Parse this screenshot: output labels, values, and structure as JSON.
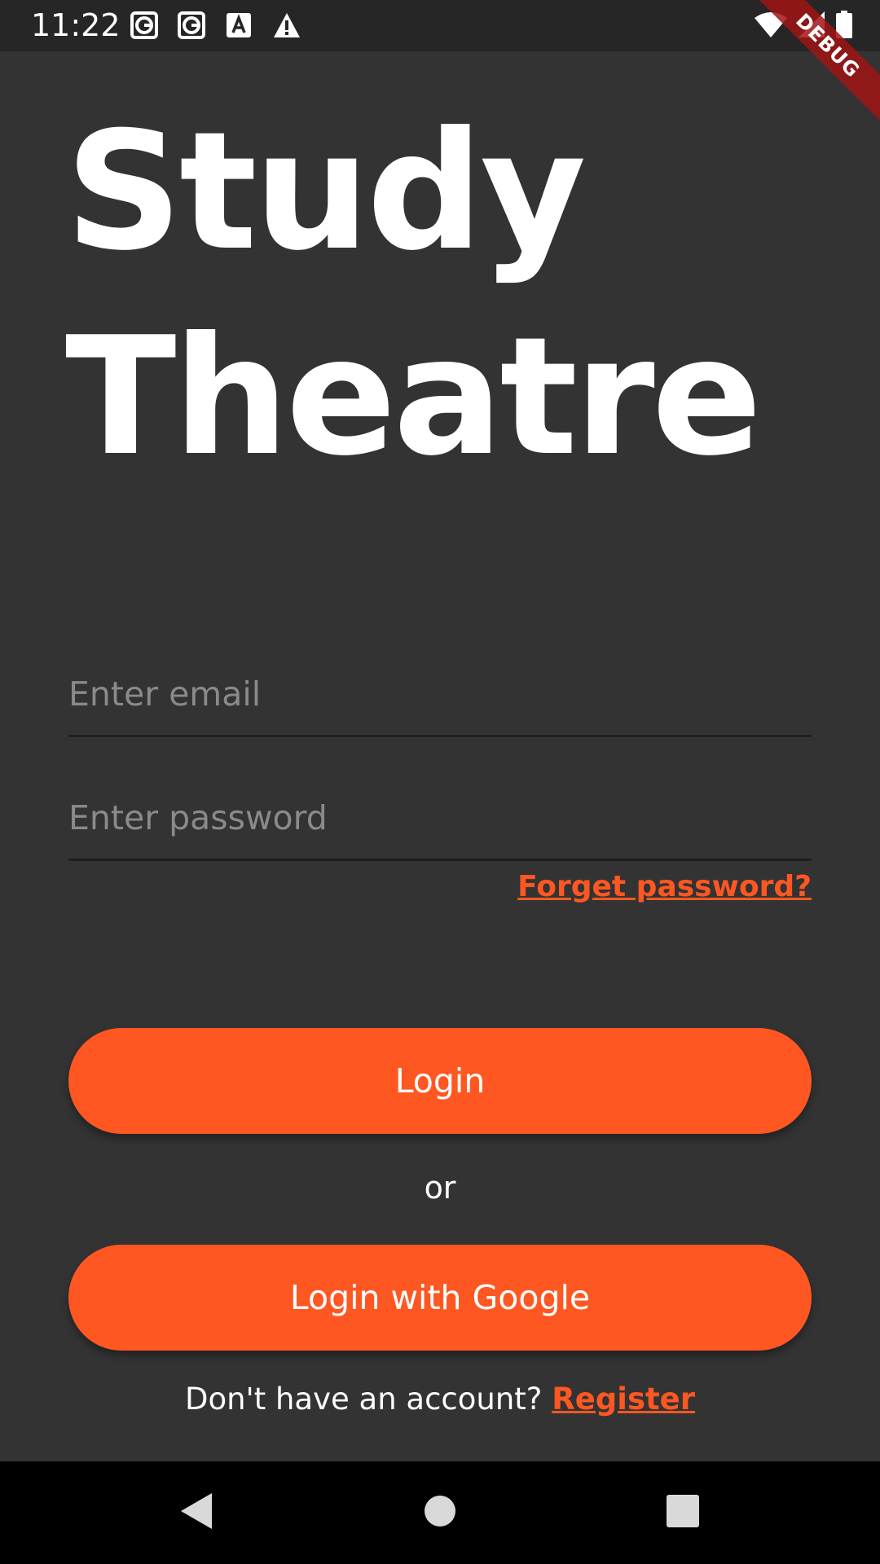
{
  "status_bar": {
    "time": "11:22",
    "left_icons": [
      "g-notification-icon",
      "g-notification-icon",
      "a-notification-icon",
      "warning-icon"
    ],
    "right_icons": [
      "wifi-icon",
      "cell-signal-icon",
      "battery-icon"
    ],
    "debug_label": "DEBUG"
  },
  "app": {
    "title_line1": "Study",
    "title_line2": "Theatre",
    "accent_color": "#ff5722",
    "background_color": "#333333"
  },
  "form": {
    "email_placeholder": "Enter email",
    "email_value": "",
    "password_placeholder": "Enter password",
    "password_value": "",
    "forget_password_label": "Forget password?"
  },
  "actions": {
    "login_label": "Login",
    "or_label": "or",
    "google_login_label": "Login with Google",
    "no_account_text": "Don't have an account?",
    "register_label": "Register"
  },
  "nav_bar": {
    "icons": [
      "back-icon",
      "home-icon",
      "recents-icon"
    ]
  }
}
